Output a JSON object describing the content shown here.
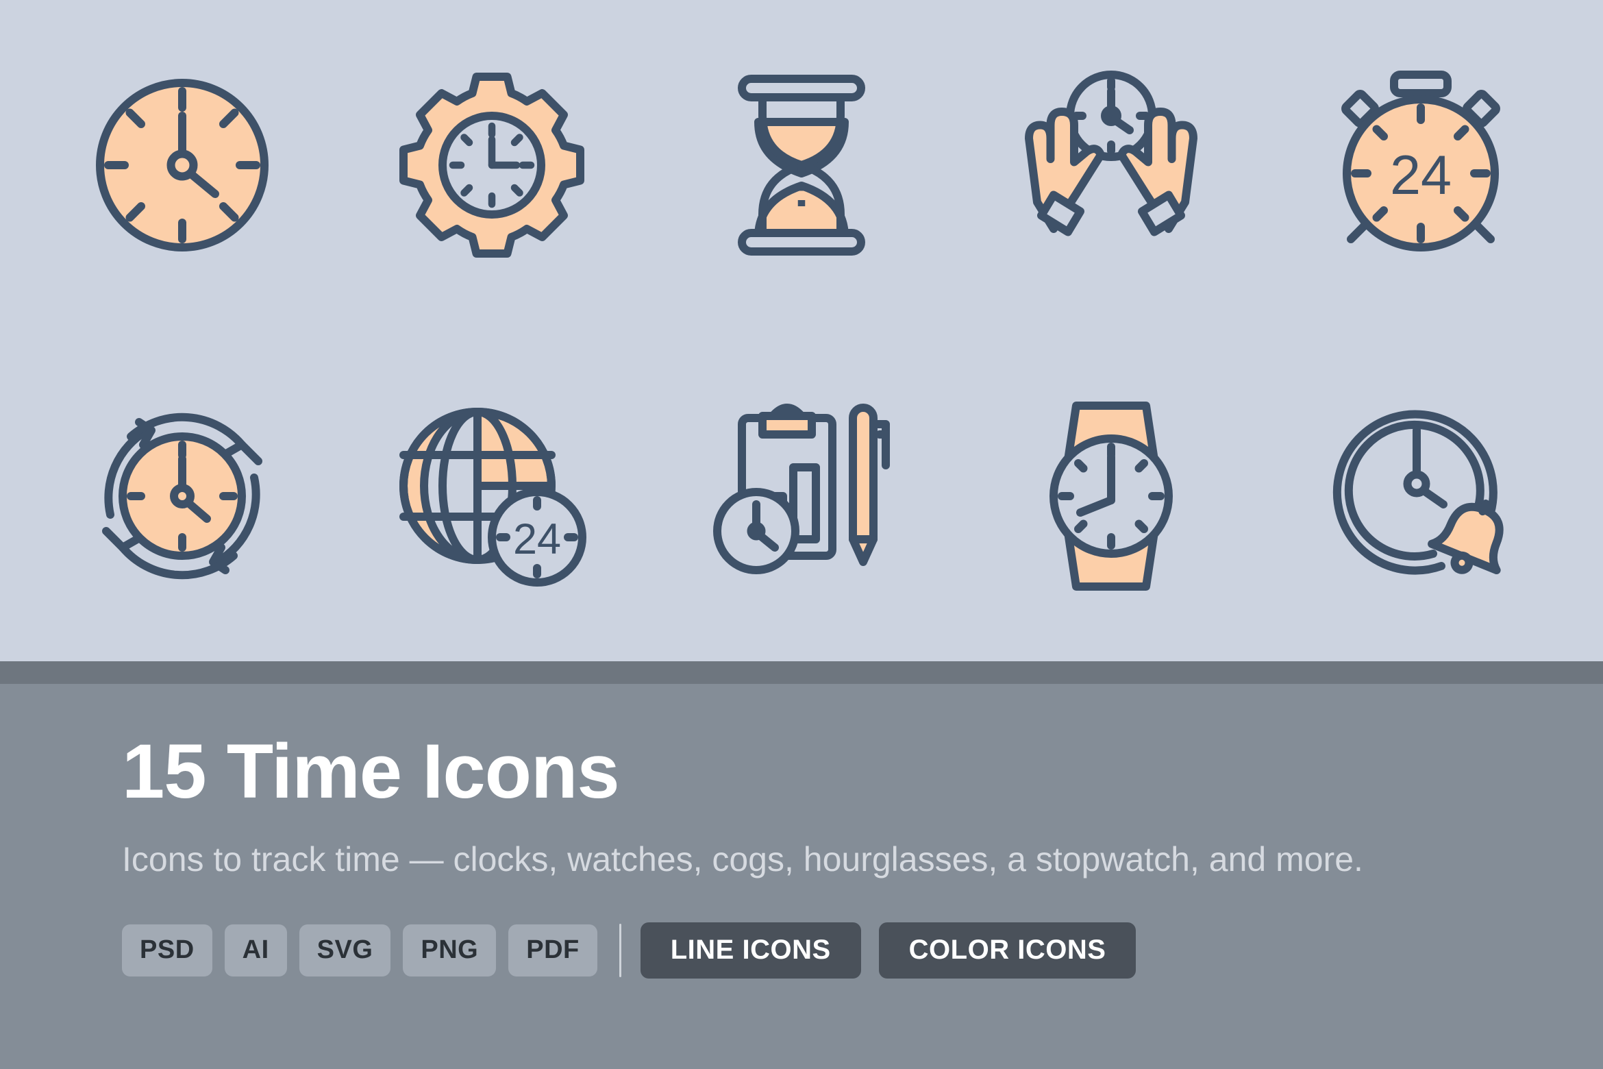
{
  "colors": {
    "showcase_bg": "#ccd3e0",
    "divider_strip": "#6e767f",
    "footer_bg": "#848d97",
    "icon_stroke": "#3e5168",
    "icon_fill": "#fccfa9",
    "chip_bg": "#a2aab4",
    "chip_text": "#2b3137",
    "cta_bg": "#4a515a",
    "title_text": "#ffffff",
    "subtitle_text": "#d6dae0"
  },
  "footer": {
    "title": "15 Time Icons",
    "subtitle": "Icons to track time — clocks, watches, cogs, hourglasses, a stopwatch, and more.",
    "formats": [
      "PSD",
      "AI",
      "SVG",
      "PNG",
      "PDF"
    ],
    "buttons": [
      {
        "label": "LINE ICONS"
      },
      {
        "label": "COLOR ICONS"
      }
    ]
  },
  "icons": [
    {
      "id": "clock",
      "name": "clock-icon",
      "row": 1,
      "col": 1,
      "label": "Clock"
    },
    {
      "id": "cog-clock",
      "name": "cog-clock-icon",
      "row": 1,
      "col": 2,
      "label": "Cog Clock"
    },
    {
      "id": "hourglass",
      "name": "hourglass-icon",
      "row": 1,
      "col": 3,
      "label": "Hourglass"
    },
    {
      "id": "hands-clock",
      "name": "hands-holding-clock-icon",
      "row": 1,
      "col": 4,
      "label": "Hands Holding Clock"
    },
    {
      "id": "stopwatch-24",
      "name": "stopwatch-24-icon",
      "row": 1,
      "col": 5,
      "label": "24 Stopwatch",
      "text": "24"
    },
    {
      "id": "recurring-clock",
      "name": "recurring-clock-icon",
      "row": 2,
      "col": 1,
      "label": "Recurring Clock"
    },
    {
      "id": "globe-24",
      "name": "globe-24-icon",
      "row": 2,
      "col": 2,
      "label": "24 Hour Globe",
      "text": "24"
    },
    {
      "id": "clipboard-clock",
      "name": "clipboard-clock-pen-icon",
      "row": 2,
      "col": 3,
      "label": "Clipboard Report with Clock and Pen"
    },
    {
      "id": "wristwatch",
      "name": "wristwatch-icon",
      "row": 2,
      "col": 4,
      "label": "Wristwatch"
    },
    {
      "id": "alarm-clock-bell",
      "name": "alarm-clock-bell-icon",
      "row": 2,
      "col": 5,
      "label": "Clock with Alarm Bell"
    }
  ]
}
